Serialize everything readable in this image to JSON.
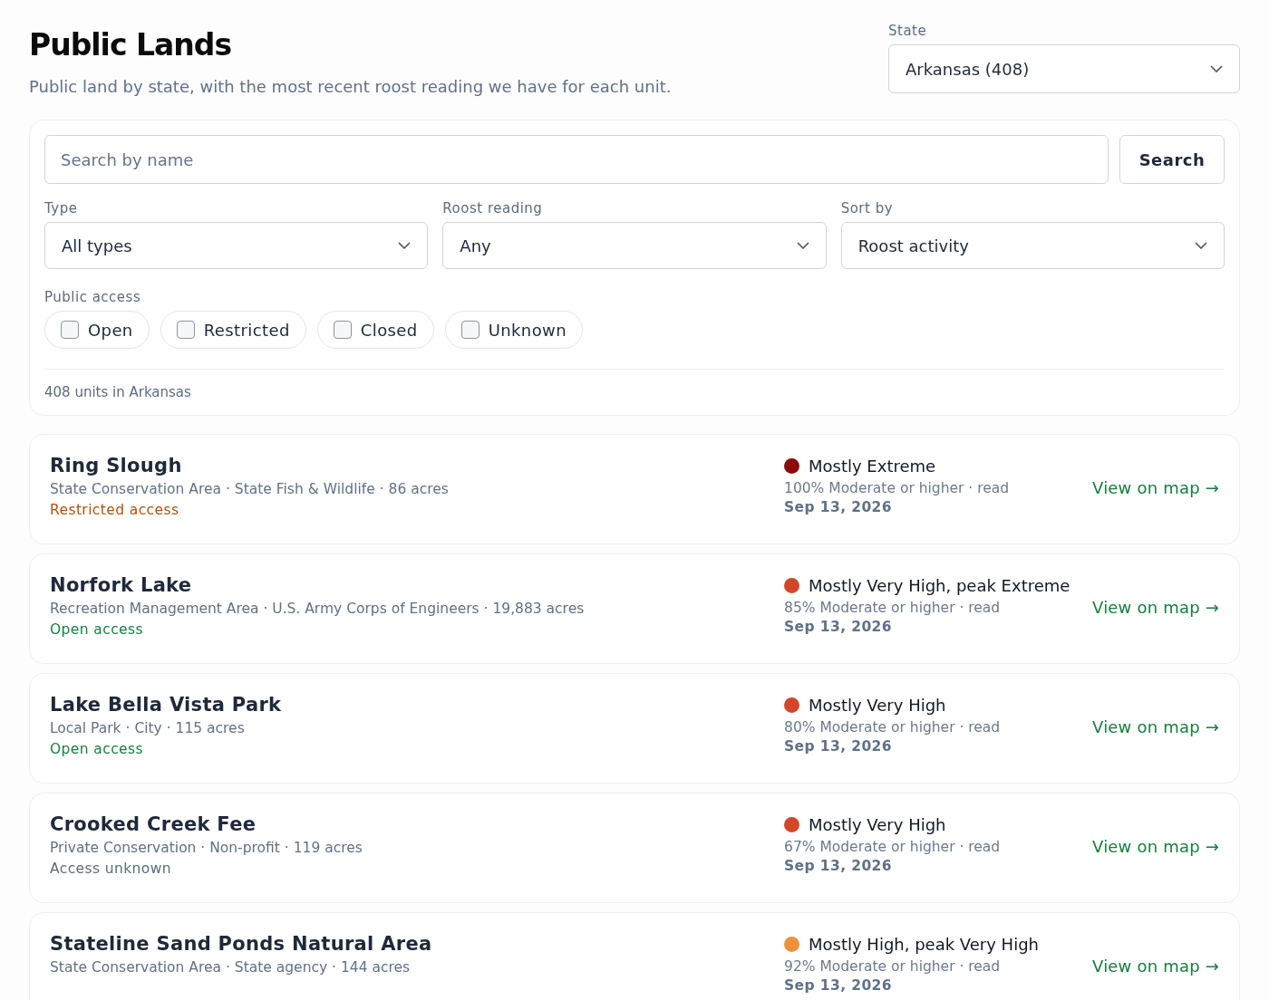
{
  "header": {
    "title": "Public Lands",
    "subtitle": "Public land by state, with the most recent roost reading we have for each unit."
  },
  "state_select": {
    "label": "State",
    "value": "Arkansas (408)"
  },
  "filters": {
    "search": {
      "placeholder": "Search by name",
      "button": "Search"
    },
    "selects": [
      {
        "label": "Type",
        "value": "All types"
      },
      {
        "label": "Roost reading",
        "value": "Any"
      },
      {
        "label": "Sort by",
        "value": "Roost activity"
      }
    ],
    "access": {
      "label": "Public access",
      "options": [
        {
          "label": "Open",
          "checked": false
        },
        {
          "label": "Restricted",
          "checked": false
        },
        {
          "label": "Closed",
          "checked": false
        },
        {
          "label": "Unknown",
          "checked": false
        }
      ]
    },
    "count": "408 units in Arkansas"
  },
  "units": [
    {
      "name": "Ring Slough",
      "meta": "State Conservation Area · State Fish & Wildlife · 86 acres",
      "access": {
        "kind": "restricted",
        "text": "Restricted access"
      },
      "reading": "Mostly Extreme",
      "color": "#8b0a0a",
      "detail": "100% Moderate or higher · read",
      "date": "Sep 13, 2026",
      "link": "View on map →"
    },
    {
      "name": "Norfork Lake",
      "meta": "Recreation Management Area · U.S. Army Corps of Engineers · 19,883 acres",
      "access": {
        "kind": "open",
        "text": "Open access"
      },
      "reading": "Mostly Very High, peak Extreme",
      "color": "#d4462a",
      "detail": "85% Moderate or higher · read",
      "date": "Sep 13, 2026",
      "link": "View on map →"
    },
    {
      "name": "Lake Bella Vista Park",
      "meta": "Local Park · City · 115 acres",
      "access": {
        "kind": "open",
        "text": "Open access"
      },
      "reading": "Mostly Very High",
      "color": "#d4462a",
      "detail": "80% Moderate or higher · read",
      "date": "Sep 13, 2026",
      "link": "View on map →"
    },
    {
      "name": "Crooked Creek Fee",
      "meta": "Private Conservation · Non-profit · 119 acres",
      "access": {
        "kind": "unknown",
        "text": "Access unknown"
      },
      "reading": "Mostly Very High",
      "color": "#d4462a",
      "detail": "67% Moderate or higher · read",
      "date": "Sep 13, 2026",
      "link": "View on map →"
    },
    {
      "name": "Stateline Sand Ponds Natural Area",
      "meta": "State Conservation Area · State agency · 144 acres",
      "reading": "Mostly High, peak Very High",
      "color": "#ec913c",
      "detail": "92% Moderate or higher · read",
      "date": "Sep 13, 2026",
      "link": "View on map →"
    }
  ]
}
